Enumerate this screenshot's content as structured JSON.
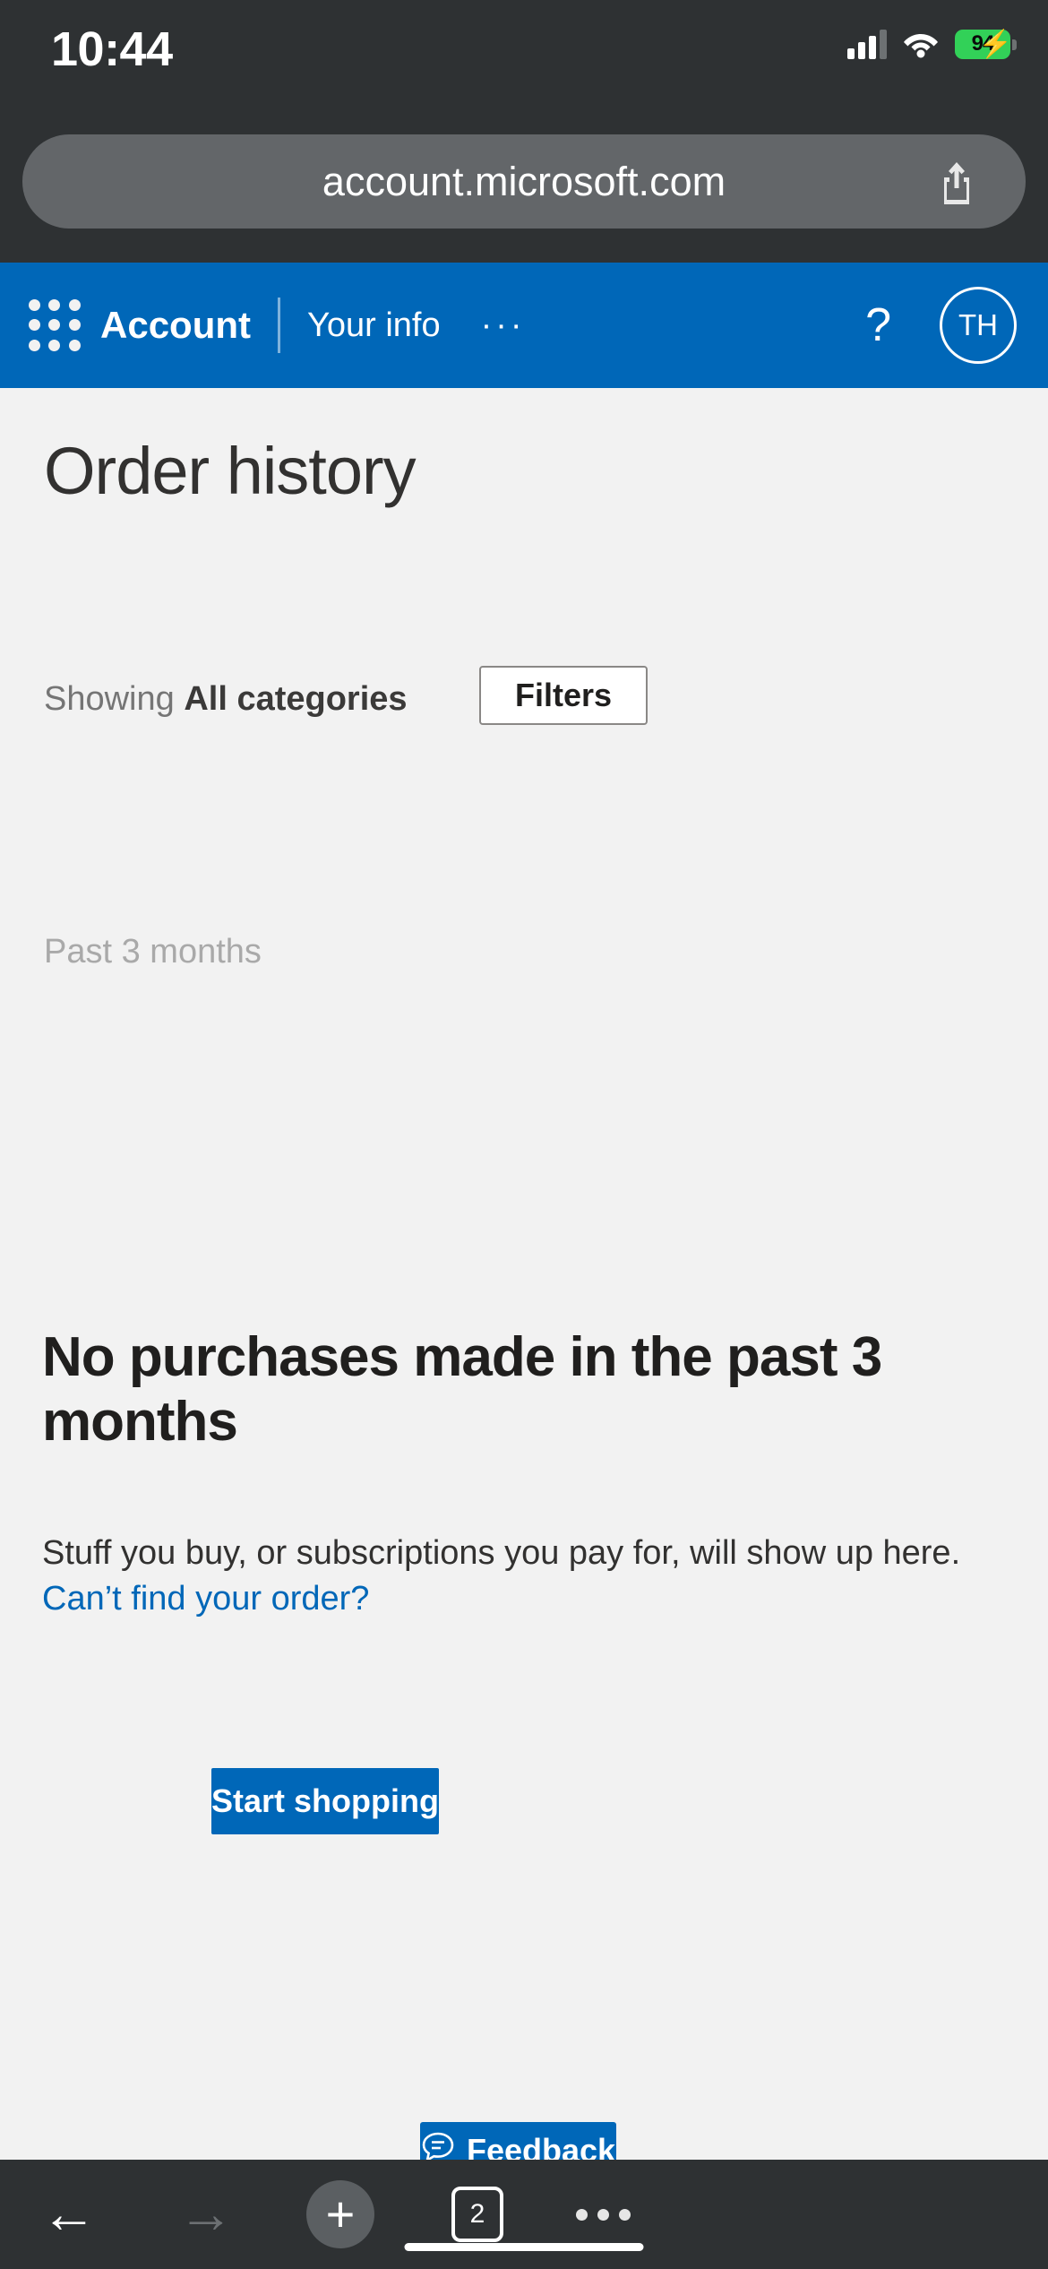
{
  "status_bar": {
    "time": "10:44",
    "battery_percent": "94",
    "battery_charging": true,
    "signal_bars_filled": 3,
    "signal_bars_total": 4,
    "wifi": "wifi-icon",
    "battery_color": "#32D158"
  },
  "browser": {
    "url": "account.microsoft.com",
    "share_icon": "share-icon",
    "toolbar": {
      "back_label": "←",
      "forward_label": "→",
      "new_tab_label": "+",
      "tab_count": "2",
      "more_label": "···"
    }
  },
  "site_header": {
    "waffle_icon": "app-launcher-icon",
    "brand": "Account",
    "nav_item": "Your info",
    "overflow": "···",
    "help_icon": "?",
    "avatar_initials": "TH",
    "background_color": "#0067B8"
  },
  "main": {
    "page_title": "Order history",
    "showing_prefix": "Showing ",
    "showing_value": "All categories",
    "filters_button": "Filters",
    "date_range": "Past 3 months",
    "empty_heading": "No purchases made in the past 3 months",
    "empty_body": "Stuff you buy, or subscriptions you pay for, will show up here. ",
    "empty_link": "Can’t find your order?",
    "start_shopping_button": "Start shopping",
    "feedback_button": "Feedback",
    "feedback_icon": "feedback-bubble-icon",
    "accent_color": "#0067B8",
    "background_color": "#f2f2f2"
  }
}
